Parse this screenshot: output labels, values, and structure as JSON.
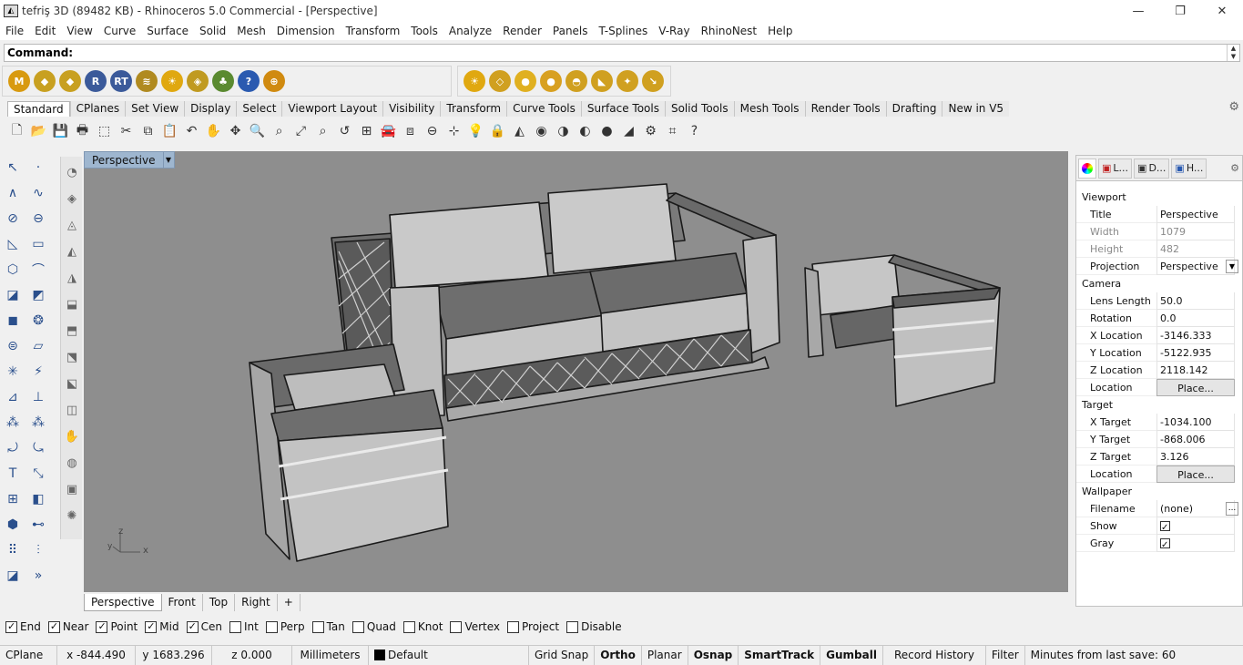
{
  "window": {
    "title": "tefriş 3D (89482 KB) - Rhinoceros 5.0 Commercial - [Perspective]",
    "minimize": "—",
    "restore": "❐",
    "close": "✕"
  },
  "menu": [
    "File",
    "Edit",
    "View",
    "Curve",
    "Surface",
    "Solid",
    "Mesh",
    "Dimension",
    "Transform",
    "Tools",
    "Analyze",
    "Render",
    "Panels",
    "T-Splines",
    "V-Ray",
    "RhinoNest",
    "Help"
  ],
  "command": {
    "label": "Command:"
  },
  "big_toolbar_left": [
    {
      "icon": "maxwell-icon",
      "glyph": "M",
      "color": "#d89a10"
    },
    {
      "icon": "material-tag-icon",
      "glyph": "◆",
      "color": "#c8a020"
    },
    {
      "icon": "texture-tag-icon",
      "glyph": "◆",
      "color": "#c8a020"
    },
    {
      "icon": "render-icon",
      "glyph": "R",
      "color": "#3b5a9a"
    },
    {
      "icon": "realtime-render-icon",
      "glyph": "RT",
      "color": "#3b5a9a"
    },
    {
      "icon": "lights-icon",
      "glyph": "≋",
      "color": "#b08a20"
    },
    {
      "icon": "sun-icon",
      "glyph": "☀",
      "color": "#e0a810"
    },
    {
      "icon": "emitter-icon",
      "glyph": "◈",
      "color": "#c09a20"
    },
    {
      "icon": "tree-icon",
      "glyph": "♣",
      "color": "#5a8a30"
    },
    {
      "icon": "help-icon",
      "glyph": "?",
      "color": "#2a5ab0"
    },
    {
      "icon": "target-icon",
      "glyph": "⊕",
      "color": "#d08a10"
    }
  ],
  "big_toolbar_right": [
    {
      "icon": "sun-icon",
      "glyph": "☀",
      "color": "#e0a810"
    },
    {
      "icon": "light-plane-icon",
      "glyph": "◇",
      "color": "#d0a020"
    },
    {
      "icon": "sphere-light-icon",
      "glyph": "●",
      "color": "#e0b020"
    },
    {
      "icon": "omni-light-icon",
      "glyph": "●",
      "color": "#d8a020"
    },
    {
      "icon": "dome-light-icon",
      "glyph": "◓",
      "color": "#d0a020"
    },
    {
      "icon": "spot-light-icon",
      "glyph": "◣",
      "color": "#d0a020"
    },
    {
      "icon": "ies-light-icon",
      "glyph": "✦",
      "color": "#d0a020"
    },
    {
      "icon": "direct-light-icon",
      "glyph": "↘",
      "color": "#d0a020"
    }
  ],
  "tabs": [
    "Standard",
    "CPlanes",
    "Set View",
    "Display",
    "Select",
    "Viewport Layout",
    "Visibility",
    "Transform",
    "Curve Tools",
    "Surface Tools",
    "Solid Tools",
    "Mesh Tools",
    "Render Tools",
    "Drafting",
    "New in V5"
  ],
  "std_tools": [
    {
      "icon": "new-file-icon",
      "glyph": "🗋"
    },
    {
      "icon": "open-icon",
      "glyph": "📂"
    },
    {
      "icon": "save-icon",
      "glyph": "💾"
    },
    {
      "icon": "print-icon",
      "glyph": "🖶"
    },
    {
      "icon": "import-icon",
      "glyph": "⬚"
    },
    {
      "icon": "cut-icon",
      "glyph": "✂"
    },
    {
      "icon": "copy-icon",
      "glyph": "⧉"
    },
    {
      "icon": "paste-icon",
      "glyph": "📋"
    },
    {
      "icon": "undo-icon",
      "glyph": "↶"
    },
    {
      "icon": "pan-hand-icon",
      "glyph": "✋"
    },
    {
      "icon": "rotate-view-icon",
      "glyph": "✥"
    },
    {
      "icon": "zoom-icon",
      "glyph": "🔍"
    },
    {
      "icon": "zoom-window-icon",
      "glyph": "⌕"
    },
    {
      "icon": "zoom-extents-icon",
      "glyph": "⤢"
    },
    {
      "icon": "zoom-selected-icon",
      "glyph": "⌕"
    },
    {
      "icon": "undo-view-icon",
      "glyph": "↺"
    },
    {
      "icon": "four-viewports-icon",
      "glyph": "⊞"
    },
    {
      "icon": "car-icon",
      "glyph": "🚘"
    },
    {
      "icon": "grid-object-icon",
      "glyph": "⧈"
    },
    {
      "icon": "snap-icon",
      "glyph": "⊖"
    },
    {
      "icon": "points-icon",
      "glyph": "⊹"
    },
    {
      "icon": "bulb-icon",
      "glyph": "💡"
    },
    {
      "icon": "lock-icon",
      "glyph": "🔒"
    },
    {
      "icon": "layer-icon",
      "glyph": "◭"
    },
    {
      "icon": "color-wheel-icon",
      "glyph": "◉"
    },
    {
      "icon": "shaded-sphere-icon",
      "glyph": "◑"
    },
    {
      "icon": "rendered-sphere-icon",
      "glyph": "◐"
    },
    {
      "icon": "blue-sphere-icon",
      "glyph": "●"
    },
    {
      "icon": "light-icon",
      "glyph": "◢"
    },
    {
      "icon": "options-gear-icon",
      "glyph": "⚙"
    },
    {
      "icon": "snapshot-icon",
      "glyph": "⌗"
    },
    {
      "icon": "help-icon",
      "glyph": "?"
    }
  ],
  "left_tools": [
    {
      "icon": "select-arrow-icon",
      "glyph": "↖"
    },
    {
      "icon": "point-icon",
      "glyph": "·"
    },
    {
      "icon": "polyline-icon",
      "glyph": "∧"
    },
    {
      "icon": "curve-icon",
      "glyph": "∿"
    },
    {
      "icon": "circle-icon",
      "glyph": "⊘"
    },
    {
      "icon": "ellipse-icon",
      "glyph": "⊖"
    },
    {
      "icon": "arc-icon",
      "glyph": "◺"
    },
    {
      "icon": "rectangle-icon",
      "glyph": "▭"
    },
    {
      "icon": "polygon-icon",
      "glyph": "⬡"
    },
    {
      "icon": "fillet-icon",
      "glyph": "⌒"
    },
    {
      "icon": "surface-icon",
      "glyph": "◪"
    },
    {
      "icon": "loft-icon",
      "glyph": "◩"
    },
    {
      "icon": "box-icon",
      "glyph": "◼"
    },
    {
      "icon": "sphere-group-icon",
      "glyph": "❂"
    },
    {
      "icon": "cylinder-icon",
      "glyph": "⊜"
    },
    {
      "icon": "extrude-icon",
      "glyph": "▱"
    },
    {
      "icon": "mesh-icon",
      "glyph": "✳"
    },
    {
      "icon": "split-icon",
      "glyph": "⚡"
    },
    {
      "icon": "boolean-icon",
      "glyph": "⊿"
    },
    {
      "icon": "cap-icon",
      "glyph": "⊥"
    },
    {
      "icon": "group-icon",
      "glyph": "⁂"
    },
    {
      "icon": "ungroup-icon",
      "glyph": "⁂"
    },
    {
      "icon": "move-icon",
      "glyph": "⤾"
    },
    {
      "icon": "rotate-icon",
      "glyph": "⤿"
    },
    {
      "icon": "text-icon",
      "glyph": "T"
    },
    {
      "icon": "scale-icon",
      "glyph": "⤡"
    },
    {
      "icon": "array-icon",
      "glyph": "⊞"
    },
    {
      "icon": "mirror-icon",
      "glyph": "◧"
    },
    {
      "icon": "block-icon",
      "glyph": "⬢"
    },
    {
      "icon": "dimension-icon",
      "glyph": "⊷"
    },
    {
      "icon": "grid-array-icon",
      "glyph": "⠿"
    },
    {
      "icon": "align-icon",
      "glyph": "⫶"
    },
    {
      "icon": "analyze-icon",
      "glyph": "◪"
    },
    {
      "icon": "more-icon",
      "glyph": "»"
    }
  ],
  "left_tools2": [
    {
      "icon": "circle-tool-icon",
      "glyph": "◔"
    },
    {
      "icon": "sweep-icon",
      "glyph": "◈"
    },
    {
      "icon": "revolve-icon",
      "glyph": "◬"
    },
    {
      "icon": "offset-icon",
      "glyph": "◭"
    },
    {
      "icon": "trim-icon",
      "glyph": "◮"
    },
    {
      "icon": "join-icon",
      "glyph": "⬓"
    },
    {
      "icon": "explode-icon",
      "glyph": "⬒"
    },
    {
      "icon": "extend-icon",
      "glyph": "⬔"
    },
    {
      "icon": "chamfer-icon",
      "glyph": "⬕"
    },
    {
      "icon": "rebuild-icon",
      "glyph": "◫"
    },
    {
      "icon": "hand-tool-icon",
      "glyph": "✋"
    },
    {
      "icon": "sphere-tool-icon",
      "glyph": "◍"
    },
    {
      "icon": "cage-icon",
      "glyph": "▣"
    },
    {
      "icon": "gear-tool-icon",
      "glyph": "✺"
    }
  ],
  "viewport": {
    "title": "Perspective",
    "axis_z": "z",
    "axis_x": "x",
    "axis_y": "y"
  },
  "viewport_tabs": [
    "Perspective",
    "Front",
    "Top",
    "Right",
    "+"
  ],
  "panel": {
    "tabs": [
      {
        "icon": "properties-icon",
        "label": ""
      },
      {
        "icon": "layers-icon",
        "label": "L..."
      },
      {
        "icon": "display-icon",
        "label": "D..."
      },
      {
        "icon": "help-panel-icon",
        "label": "H..."
      }
    ],
    "viewport_section": "Viewport",
    "title_label": "Title",
    "title_value": "Perspective",
    "width_label": "Width",
    "width_value": "1079",
    "height_label": "Height",
    "height_value": "482",
    "projection_label": "Projection",
    "projection_value": "Perspective",
    "camera_section": "Camera",
    "lens_label": "Lens Length",
    "lens_value": "50.0",
    "rotation_label": "Rotation",
    "rotation_value": "0.0",
    "xloc_label": "X Location",
    "xloc_value": "-3146.333",
    "yloc_label": "Y Location",
    "yloc_value": "-5122.935",
    "zloc_label": "Z Location",
    "zloc_value": "2118.142",
    "cam_location_label": "Location",
    "place_button": "Place...",
    "target_section": "Target",
    "xt_label": "X Target",
    "xt_value": "-1034.100",
    "yt_label": "Y Target",
    "yt_value": "-868.006",
    "zt_label": "Z Target",
    "zt_value": "3.126",
    "target_location_label": "Location",
    "wallpaper_section": "Wallpaper",
    "filename_label": "Filename",
    "filename_value": "(none)",
    "browse_button": "...",
    "show_label": "Show",
    "show_checked": true,
    "gray_label": "Gray",
    "gray_checked": true
  },
  "osnaps": [
    {
      "label": "End",
      "checked": true
    },
    {
      "label": "Near",
      "checked": true
    },
    {
      "label": "Point",
      "checked": true
    },
    {
      "label": "Mid",
      "checked": true
    },
    {
      "label": "Cen",
      "checked": true
    },
    {
      "label": "Int",
      "checked": false
    },
    {
      "label": "Perp",
      "checked": false
    },
    {
      "label": "Tan",
      "checked": false
    },
    {
      "label": "Quad",
      "checked": false
    },
    {
      "label": "Knot",
      "checked": false
    },
    {
      "label": "Vertex",
      "checked": false
    },
    {
      "label": "Project",
      "checked": false
    },
    {
      "label": "Disable",
      "checked": false
    }
  ],
  "status": {
    "cplane": "CPlane",
    "x": "x -844.490",
    "y": "y 1683.296",
    "z": "z 0.000",
    "units": "Millimeters",
    "layer": "Default",
    "layer_color": "#000000",
    "grid_snap": "Grid Snap",
    "ortho": "Ortho",
    "planar": "Planar",
    "osnap": "Osnap",
    "smarttrack": "SmartTrack",
    "gumball": "Gumball",
    "record_history": "Record History",
    "filter": "Filter",
    "save_info": "Minutes from last save: 60"
  }
}
